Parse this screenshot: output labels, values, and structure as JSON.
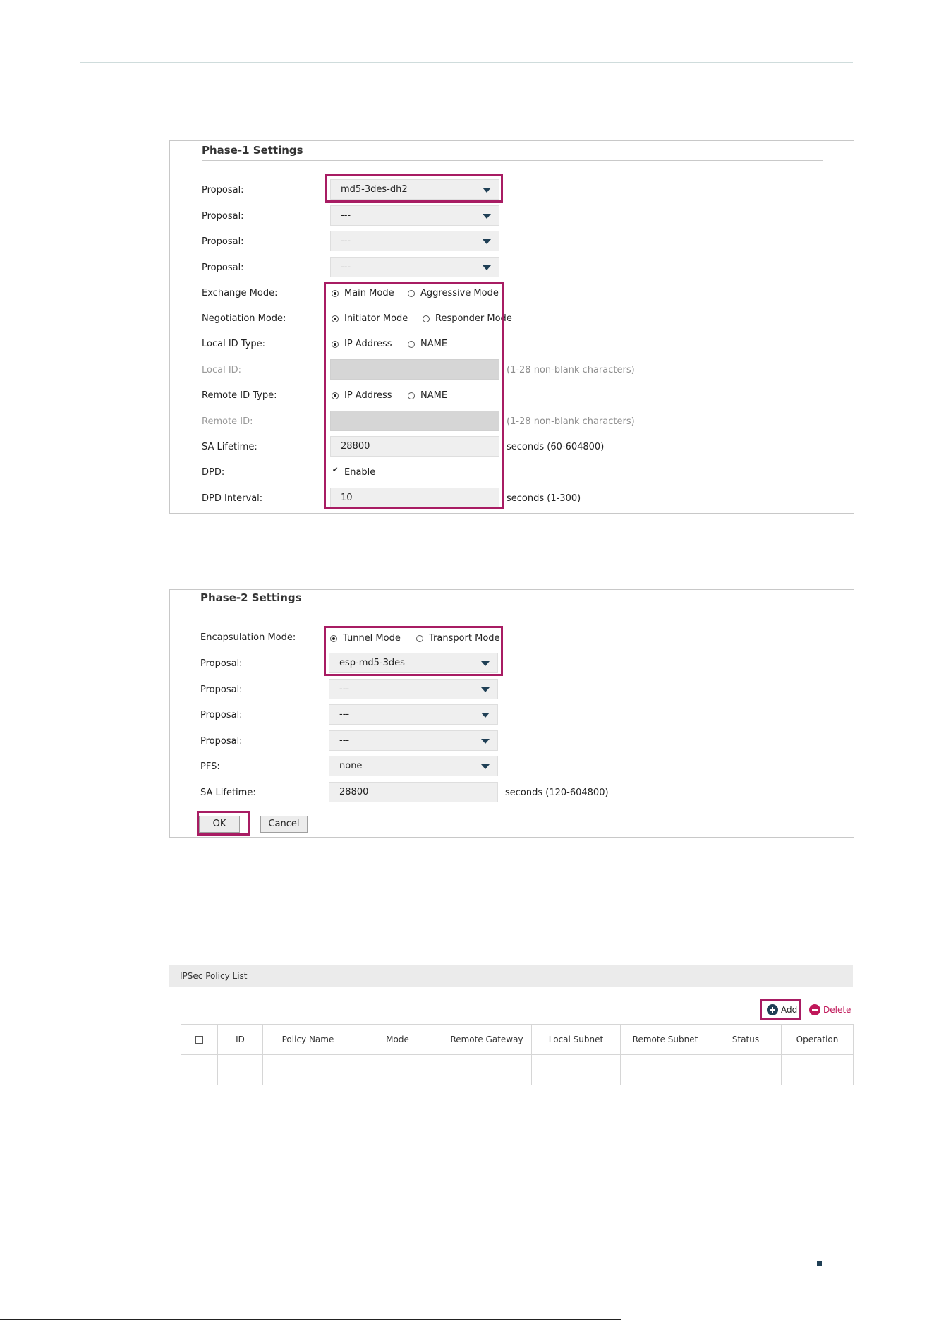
{
  "phase1": {
    "title": "Phase-1 Settings",
    "proposal_label": "Proposal:",
    "proposal_1": "md5-3des-dh2",
    "proposal_2": "---",
    "proposal_3": "---",
    "proposal_4": "---",
    "exchange_mode_label": "Exchange Mode:",
    "exchange_main": "Main Mode",
    "exchange_aggressive": "Aggressive Mode",
    "negotiation_mode_label": "Negotiation Mode:",
    "negotiation_initiator": "Initiator Mode",
    "negotiation_responder": "Responder Mode",
    "local_id_type_label": "Local ID Type:",
    "local_id_ip": "IP Address",
    "local_id_name": "NAME",
    "local_id_label": "Local ID:",
    "local_id_hint": "(1-28 non-blank characters)",
    "remote_id_type_label": "Remote ID Type:",
    "remote_id_ip": "IP Address",
    "remote_id_name": "NAME",
    "remote_id_label": "Remote ID:",
    "remote_id_hint": "(1-28 non-blank characters)",
    "sa_lifetime_label": "SA Lifetime:",
    "sa_lifetime_value": "28800",
    "sa_lifetime_hint": "seconds (60-604800)",
    "dpd_label": "DPD:",
    "dpd_enable": "Enable",
    "dpd_interval_label": "DPD Interval:",
    "dpd_interval_value": "10",
    "dpd_interval_hint": "seconds (1-300)"
  },
  "phase2": {
    "title": "Phase-2 Settings",
    "encapsulation_label": "Encapsulation Mode:",
    "encapsulation_tunnel": "Tunnel Mode",
    "encapsulation_transport": "Transport Mode",
    "proposal_label": "Proposal:",
    "proposal_1": "esp-md5-3des",
    "proposal_2": "---",
    "proposal_3": "---",
    "proposal_4": "---",
    "pfs_label": "PFS:",
    "pfs_value": "none",
    "sa_lifetime_label": "SA Lifetime:",
    "sa_lifetime_value": "28800",
    "sa_lifetime_hint": "seconds (120-604800)",
    "ok_label": "OK",
    "cancel_label": "Cancel"
  },
  "policy_list": {
    "title": "IPSec Policy List",
    "add_label": "Add",
    "delete_label": "Delete",
    "columns": [
      "ID",
      "Policy Name",
      "Mode",
      "Remote Gateway",
      "Local Subnet",
      "Remote Subnet",
      "Status",
      "Operation"
    ],
    "row": [
      "--",
      "--",
      "--",
      "--",
      "--",
      "--",
      "--",
      "--",
      "--"
    ]
  },
  "colors": {
    "highlight": "#a81c63",
    "accent_dark": "#1f3f55",
    "delete": "#c0185a"
  },
  "icons": {
    "dropdown": "chevron-down-icon",
    "add": "plus-circle-icon",
    "delete": "minus-circle-icon"
  }
}
